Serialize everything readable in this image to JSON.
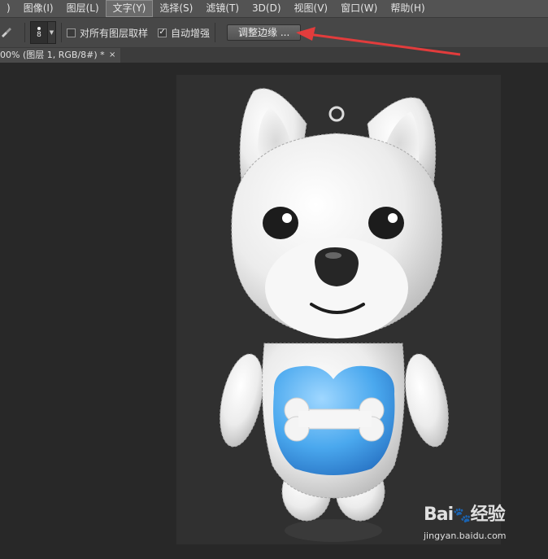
{
  "menubar": {
    "items": [
      {
        "label": ")"
      },
      {
        "label": "图像(I)"
      },
      {
        "label": "图层(L)"
      },
      {
        "label": "文字(Y)"
      },
      {
        "label": "选择(S)"
      },
      {
        "label": "滤镜(T)"
      },
      {
        "label": "3D(D)"
      },
      {
        "label": "视图(V)"
      },
      {
        "label": "窗口(W)"
      },
      {
        "label": "帮助(H)"
      }
    ],
    "active_index": 3
  },
  "optbar": {
    "brush_size": "8",
    "sample_all_layers_label": "对所有图层取样",
    "sample_all_layers_checked": false,
    "auto_enhance_label": "自动增强",
    "auto_enhance_checked": true,
    "refine_edge_label": "调整边缘 ..."
  },
  "document": {
    "tab_title": "00% (图层 1, RGB/8#) *",
    "close_glyph": "×"
  },
  "watermark": {
    "logo": "Bai",
    "logo_suffix": "经验",
    "site": "jingyan.baidu.com"
  },
  "annotation": {
    "arrow_color": "#e23c3c"
  }
}
